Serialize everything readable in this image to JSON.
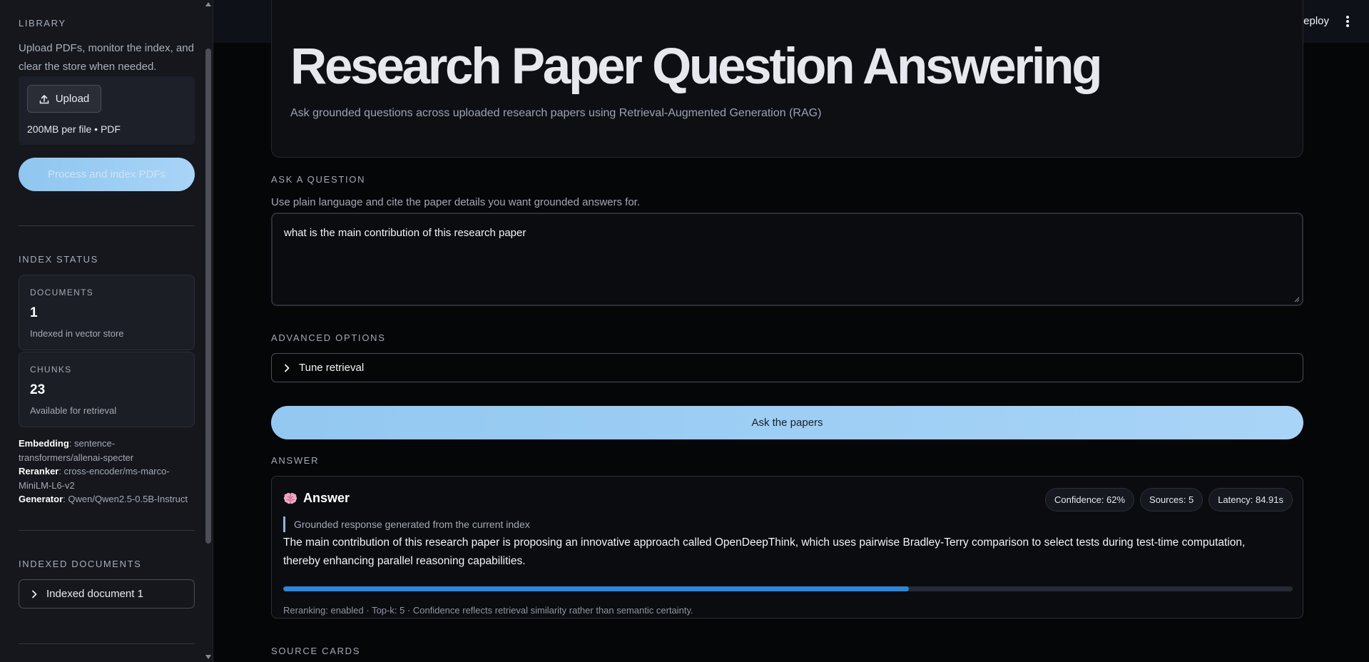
{
  "sidebar": {
    "library": {
      "title": "LIBRARY",
      "description": "Upload PDFs, monitor the index, and clear the store when needed.",
      "upload_label": "Upload",
      "upload_limit": "200MB per file • PDF",
      "process_label": "Process and index PDFs"
    },
    "index_status": {
      "title": "INDEX STATUS",
      "documents": {
        "label": "DOCUMENTS",
        "value": "1",
        "sub": "Indexed in vector store"
      },
      "chunks": {
        "label": "CHUNKS",
        "value": "23",
        "sub": "Available for retrieval"
      }
    },
    "models": {
      "embedding_label": "Embedding",
      "embedding_value": ": sentence-transformers/allenai-specter",
      "reranker_label": "Reranker",
      "reranker_value": ": cross-encoder/ms-marco-MiniLM-L6-v2",
      "generator_label": "Generator",
      "generator_value": ": Qwen/Qwen2.5-0.5B-Instruct"
    },
    "indexed_documents": {
      "title": "INDEXED DOCUMENTS",
      "items": [
        "Indexed document 1"
      ]
    }
  },
  "topbar": {
    "deploy_label": "Deploy"
  },
  "main": {
    "title": "Research Paper Question Answering",
    "subtitle": "Ask grounded questions across uploaded research papers using Retrieval-Augmented Generation (RAG)",
    "ask": {
      "label": "ASK A QUESTION",
      "hint": "Use plain language and cite the paper details you want grounded answers for.",
      "value": "what is the main contribution of this research paper"
    },
    "advanced": {
      "label": "ADVANCED OPTIONS",
      "expander_label": "Tune retrieval"
    },
    "ask_button": "Ask the papers",
    "answer": {
      "section_label": "ANSWER",
      "icon": "brain-icon",
      "heading": "Answer",
      "confidence": "Confidence: 62%",
      "sources": "Sources: 5",
      "latency": "Latency: 84.91s",
      "note": "Grounded response generated from the current index",
      "text": "The main contribution of this research paper is proposing an innovative approach called OpenDeepThink, which uses pairwise Bradley-Terry comparison to select tests during test-time computation, thereby enhancing parallel reasoning capabilities.",
      "confidence_fraction": 0.62,
      "meta": "Reranking: enabled · Top-k: 5 · Confidence reflects retrieval similarity rather than semantic certainty."
    },
    "source_cards_label": "SOURCE CARDS"
  },
  "colors": {
    "accent": "#a8d4f7",
    "progress": "#2d86d9",
    "background": "#050608",
    "sidebar": "#15171c"
  }
}
